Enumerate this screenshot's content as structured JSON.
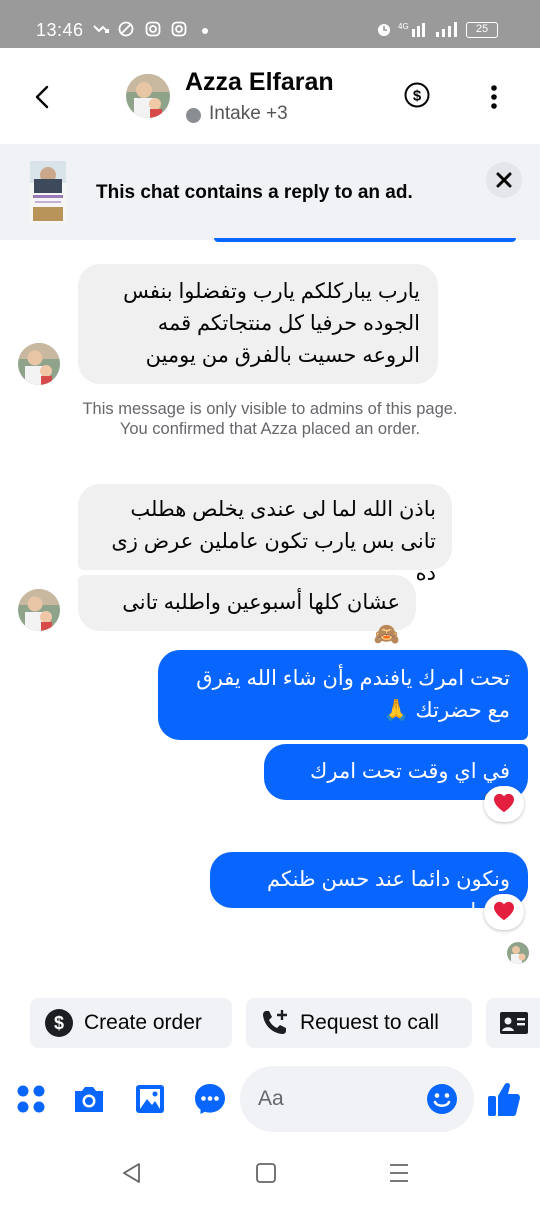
{
  "status_bar": {
    "time": "13:46",
    "battery": "25",
    "icons": [
      "missed-call-icon",
      "no-sound-icon",
      "instagram-icon",
      "instagram-icon",
      "alarm-icon",
      "4g-signal-icon",
      "signal-bars-icon",
      "battery-icon"
    ]
  },
  "header": {
    "contact_name": "Azza Elfaran",
    "subtitle": "Intake +3",
    "icons": [
      "back-arrow-icon",
      "dollar-circle-icon",
      "more-vertical-icon"
    ]
  },
  "ad_banner": {
    "text": "This chat contains a reply to an ad."
  },
  "messages": [
    {
      "from": "customer",
      "text": "يارب يباركلكم يارب وتفضلوا بنفس الجوده حرفيا كل منتجاتكم قمه الروعه حسيت بالفرق من يومين"
    },
    {
      "from": "system",
      "text": "This message is only visible to admins of this page. You confirmed that Azza placed an order."
    },
    {
      "from": "customer",
      "text": "باذن الله لما لى عندى يخلص هطلب تانى بس يارب تكون عاملين عرض زى ده"
    },
    {
      "from": "customer",
      "text": "عشان كلها أسبوعين واطلبه تانى 🙈"
    },
    {
      "from": "page",
      "text": "تحت امرك يافندم وأن شاء الله يفرق مع حضرتك 🙏"
    },
    {
      "from": "page",
      "text": "في اي وقت تحت امرك 🧡",
      "reaction": "❤️"
    },
    {
      "from": "page",
      "text": "ونكون دائما عند حسن ظنكم دائما",
      "reaction": "❤️"
    }
  ],
  "quick_actions": {
    "create_order": "Create order",
    "request_call": "Request to call"
  },
  "composer": {
    "placeholder": "Aa",
    "icons": [
      "menu-dots-icon",
      "camera-icon",
      "gallery-icon",
      "chat-bubble-icon",
      "emoji-icon",
      "thumbs-up-icon"
    ]
  },
  "colors": {
    "accent": "#0866ff",
    "incoming_bubble": "#f0f0f0",
    "status_bar": "#9a9a9a",
    "banner_bg": "#f0f2f5"
  }
}
